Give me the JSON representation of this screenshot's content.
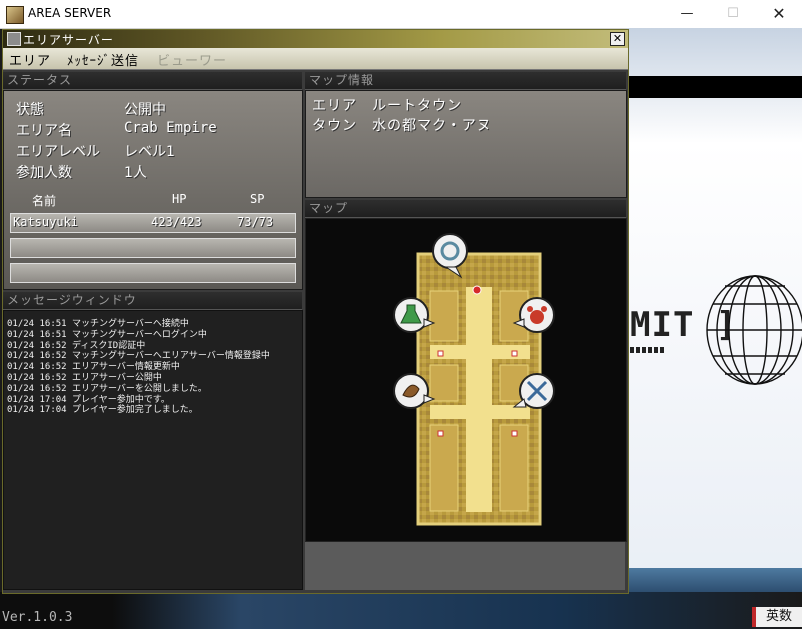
{
  "window": {
    "title": "AREA SERVER",
    "minimize_label": "—",
    "maximize_label": "☐",
    "close_label": "✕"
  },
  "app": {
    "title": "エリアサーバー",
    "close_label": "✕",
    "menu": [
      {
        "label": "エリア",
        "enabled": true
      },
      {
        "label": "ﾒｯｾｰｼﾞ送信",
        "enabled": true
      },
      {
        "label": "ビューワー",
        "enabled": false
      }
    ]
  },
  "status": {
    "header": "ステータス",
    "fields": [
      {
        "label": "状態",
        "value": "公開中"
      },
      {
        "label": "エリア名",
        "value": "Crab Empire"
      },
      {
        "label": "エリアレベル",
        "value": "レベル1"
      },
      {
        "label": "参加人数",
        "value": "1人"
      }
    ],
    "party_headers": {
      "name": "名前",
      "hp": "HP",
      "sp": "SP"
    },
    "party": [
      {
        "name": "Katsuyuki",
        "hp": "423/423",
        "sp": "73/73"
      },
      {
        "name": "",
        "hp": "",
        "sp": ""
      },
      {
        "name": "",
        "hp": "",
        "sp": ""
      }
    ]
  },
  "messages": {
    "header": "メッセージウィンドウ",
    "lines": [
      "01/24 16:51 マッチングサーバーへ接続中",
      "01/24 16:51 マッチングサーバーへログイン中",
      "01/24 16:52 ディスクID認証中",
      "01/24 16:52 マッチングサーバーへエリアサーバー情報登録中",
      "01/24 16:52 エリアサーバー情報更新中",
      "01/24 16:52 エリアサーバー公開中",
      "01/24 16:52 エリアサーバーを公開しました。",
      "01/24 17:04 プレイヤー参加中です。",
      "01/24 17:04 プレイヤー参加完了しました。"
    ]
  },
  "map_info": {
    "header": "マップ情報",
    "area_label": "エリア",
    "area_value": "ルートタウン",
    "town_label": "タウン",
    "town_value": "水の都マク・アヌ"
  },
  "map": {
    "header": "マップ",
    "icons": [
      "ring-icon",
      "potion-icon",
      "crab-icon",
      "whistle-icon",
      "crossed-swords-icon"
    ]
  },
  "footer": {
    "version": "Ver.1.0.3",
    "ime": "英数"
  },
  "background": {
    "fragment_text": "MIT ]"
  },
  "colors": {
    "titlebar_gold": "#a39a46",
    "panel_gray": "#7a7772",
    "map_floor": "#e8cf6a"
  }
}
